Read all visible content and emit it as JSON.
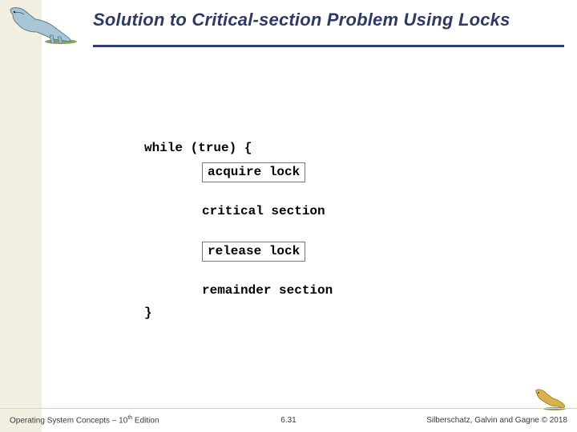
{
  "header": {
    "title": "Solution to Critical-section Problem Using Locks"
  },
  "code": {
    "line1": "while (true) {",
    "acquire": "acquire lock",
    "critical": "critical section",
    "release": "release lock",
    "remainder": "remainder section",
    "close": "}"
  },
  "footer": {
    "left_prefix": "Operating System Concepts – 10",
    "left_sup": "th",
    "left_suffix": " Edition",
    "center": "6.31",
    "right": "Silberschatz, Galvin and Gagne © 2018"
  },
  "logos": {
    "top": "dinosaur-illustration",
    "bottom": "dinosaur-illustration-small"
  }
}
